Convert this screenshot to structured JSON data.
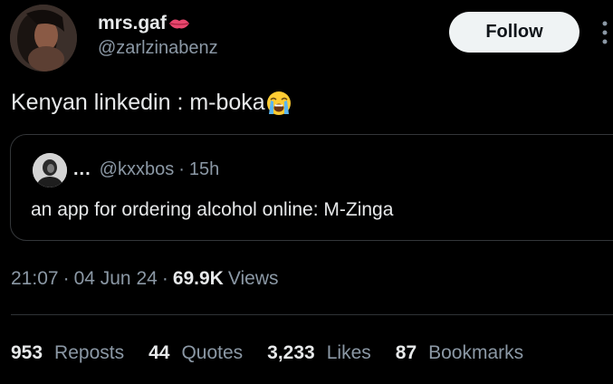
{
  "author": {
    "display_name": "mrs.gaf",
    "name_emoji": "lips-icon",
    "handle": "@zarlzinabenz"
  },
  "follow_button": {
    "label": "Follow"
  },
  "tweet": {
    "text": "Kenyan linkedin : m-boka",
    "emoji": "loudly-crying-face-icon"
  },
  "quote": {
    "name": "...",
    "handle": "@kxxbos",
    "separator": "·",
    "time": "15h",
    "text": "an app for ordering alcohol online: M-Zinga"
  },
  "meta": {
    "time": "21:07",
    "separator": "·",
    "date": "04 Jun 24",
    "views_count": "69.9K",
    "views_label": "Views"
  },
  "stats": [
    {
      "count": "953",
      "label": "Reposts"
    },
    {
      "count": "44",
      "label": "Quotes"
    },
    {
      "count": "3,233",
      "label": "Likes"
    },
    {
      "count": "87",
      "label": "Bookmarks"
    }
  ],
  "colors": {
    "background": "#000000",
    "primary_text": "#e7e9ea",
    "secondary_text": "#8b98a5",
    "border": "#333639",
    "follow_bg": "#eff3f4"
  }
}
